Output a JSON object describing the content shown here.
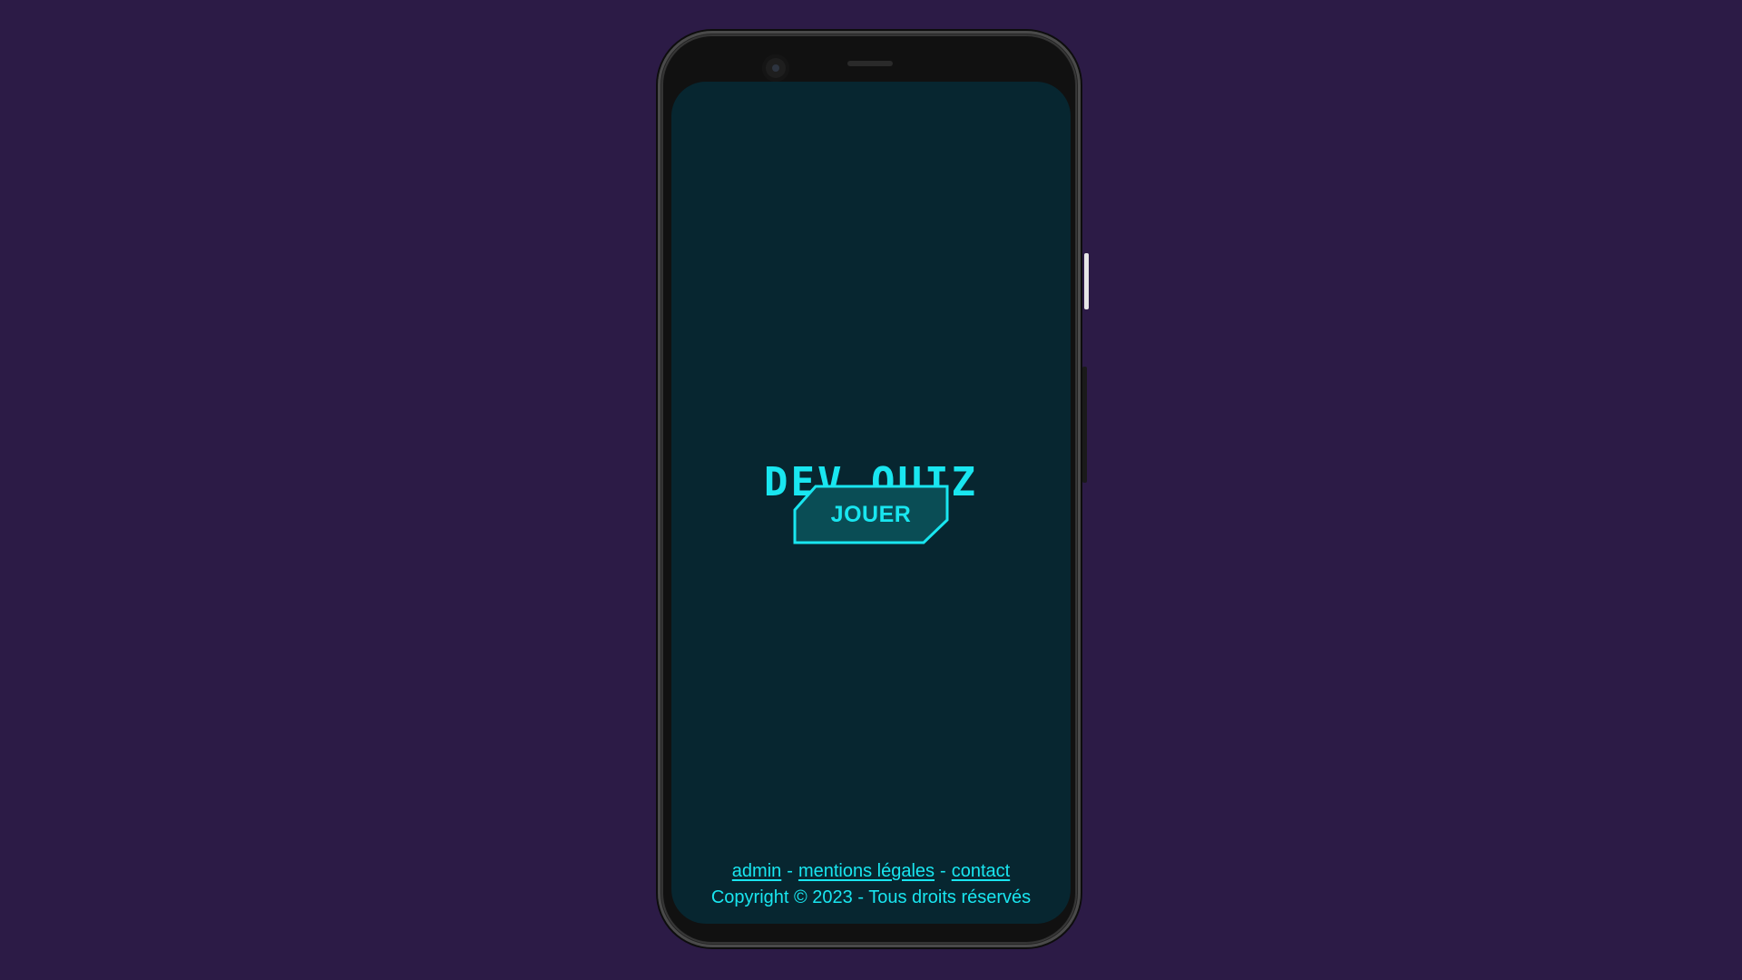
{
  "app": {
    "title": "DEV QUIZ",
    "play_button_label": "JOUER"
  },
  "footer": {
    "links": [
      {
        "label": "admin"
      },
      {
        "label": "mentions légales"
      },
      {
        "label": "contact"
      }
    ],
    "separator": "-",
    "copyright": "Copyright © 2023 - Tous droits réservés"
  },
  "colors": {
    "page_background": "#2c1b46",
    "screen_background": "#072630",
    "accent": "#19e6f0",
    "button_fill": "#0a4d55"
  }
}
